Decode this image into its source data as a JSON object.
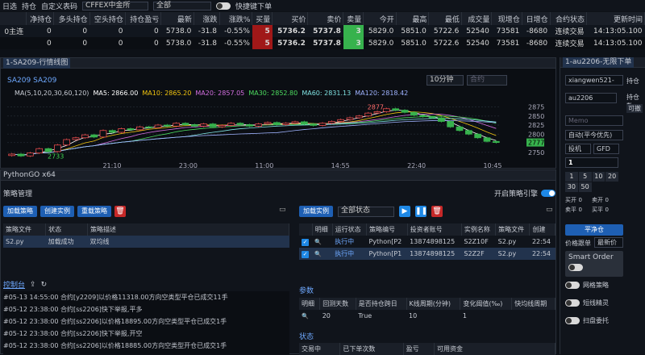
{
  "topbar": {
    "items": [
      "日选",
      "持仓",
      "自定义表码"
    ],
    "exchange": "CFFEX中金所",
    "filter": "全部",
    "quick_label": "快捷键下单"
  },
  "quote": {
    "headers": [
      "",
      "净持仓",
      "多头持仓",
      "空头持仓",
      "持仓盈亏",
      "最新",
      "涨跌",
      "涨跌%",
      "买量",
      "买价",
      "卖价",
      "卖量",
      "今开",
      "最高",
      "最低",
      "成交量",
      "现增仓",
      "日增仓",
      "合约状态",
      "更新时间"
    ],
    "rows": [
      [
        "0主连",
        "0",
        "0",
        "0",
        "0",
        "5738.0",
        "-31.8",
        "-0.55%",
        "5",
        "5736.2",
        "5737.8",
        "3",
        "5829.0",
        "5851.0",
        "5722.6",
        "52540",
        "73581",
        "-8680",
        "连续交易",
        "14:13:05.100"
      ],
      [
        "",
        "0",
        "0",
        "0",
        "0",
        "5738.0",
        "-31.8",
        "-0.55%",
        "5",
        "5736.2",
        "5737.8",
        "3",
        "5829.0",
        "5851.0",
        "5722.6",
        "52540",
        "73581",
        "-8680",
        "连续交易",
        "14:13:05.100"
      ]
    ]
  },
  "chart_panel": {
    "tab": "1-SA209-行情线图",
    "symbol": "SA209 SA209",
    "period": "10分钟",
    "search_placeholder": "合约",
    "ma": {
      "label": "MA(5,10,20,30,60,120)",
      "ma5": "MA5: 2866.00",
      "ma10": "MA10: 2865.20",
      "ma20": "MA20: 2857.05",
      "ma30": "MA30: 2852.80",
      "ma60": "MA60: 2831.13",
      "ma120": "MA120: 2818.42"
    },
    "annotations": {
      "high": "2877",
      "low": "2733"
    },
    "last": "2777"
  },
  "chart_data": {
    "type": "candlestick",
    "x_ticks": [
      "21:10",
      "23:00",
      "11:00",
      "14:55",
      "22:40",
      "10:45"
    ],
    "y_ticks": [
      2875,
      2850,
      2825,
      2800,
      2777,
      2750
    ],
    "ylim": [
      2725,
      2885
    ],
    "series_closes": [
      2745,
      2740,
      2748,
      2760,
      2752,
      2770,
      2785,
      2790,
      2798,
      2792,
      2810,
      2805,
      2815,
      2812,
      2820,
      2818,
      2825,
      2822,
      2830,
      2826,
      2822,
      2828,
      2820,
      2824,
      2830,
      2826,
      2822,
      2828,
      2832,
      2826,
      2830,
      2834,
      2828,
      2824,
      2830,
      2835,
      2840,
      2845,
      2850,
      2858,
      2862,
      2870,
      2866,
      2860,
      2852,
      2848,
      2845,
      2835,
      2820,
      2810,
      2800,
      2790,
      2780,
      2777
    ]
  },
  "pythongo": {
    "title": "PythonGO x64",
    "section": "策略管理",
    "engine_label": "开启策略引擎",
    "load_btn": "加载策略",
    "create_btn": "创建实例",
    "refresh_btn": "重载策略",
    "strat_headers": [
      "策略文件",
      "状态",
      "策略描述"
    ],
    "strat_row": [
      "S2.py",
      "加载成功",
      "双均线"
    ],
    "console_label": "控制台",
    "logs": [
      "#05-13 14:55:00 合约[y2209]以价格11318.00方向空类型平仓已成交11手",
      "#05-12 23:38:00 合约[ss2206]快下举报,平多",
      "#05-12 23:38:00 合约[ss2206]以价格18895.00方向空类型平仓已成交1手",
      "#05-12 23:38:00 合约[ss2206]快下举报,开空",
      "#05-12 23:38:00 合约[ss2206]以价格18885.00方向空类型开仓已成交1手"
    ],
    "inst_btn": "加载实例",
    "inst_filter": "全部状态",
    "inst_headers": [
      "",
      "明细",
      "运行状态",
      "策略编号",
      "投资者账号",
      "实例名称",
      "策略文件",
      "创建"
    ],
    "inst_rows": [
      [
        "",
        "",
        "执行中",
        "Python[P2",
        "13874898125",
        "S2Z10F",
        "S2.py",
        "22:54"
      ],
      [
        "",
        "",
        "执行中",
        "Python[P1",
        "13874898125",
        "S2Z2F",
        "S2.py",
        "22:54"
      ]
    ],
    "params_label": "参数",
    "param_headers": [
      "明细",
      "回测天数",
      "是否持仓跨日",
      "K线周期(分钟)",
      "变化阈值(‰)",
      "快均线周期"
    ],
    "param_row": [
      "",
      "20",
      "True",
      "10",
      "1",
      ""
    ],
    "status_label": "状态",
    "status_headers": [
      "交易中",
      "已下单次数",
      "盈亏",
      "可用资金"
    ]
  },
  "order": {
    "tab": "1-au2206-无限下单",
    "account": "xiangwen521-",
    "hold_label": "持仓",
    "contract": "au2206",
    "memo_placeholder": "Memo",
    "mode": "自动(平今优先)",
    "type": "投机",
    "tif": "GFD",
    "qty": "1",
    "nums": [
      "1",
      "5",
      "10",
      "20",
      "30",
      "50",
      "1",
      "5"
    ],
    "bid": "买开",
    "ask": "卖开",
    "labels": [
      "买开",
      "卖开",
      "卖平",
      "买平"
    ],
    "vals": [
      "0",
      "0",
      "0",
      "0"
    ],
    "flat": "平净仓",
    "price_label": "价格跟单",
    "price_mode": "最新价",
    "smart": "Smart Order",
    "opts": [
      "网格策略",
      "短线精灵",
      "扫盘委托"
    ],
    "side_label": "持仓数",
    "side_btn": "可撤"
  }
}
